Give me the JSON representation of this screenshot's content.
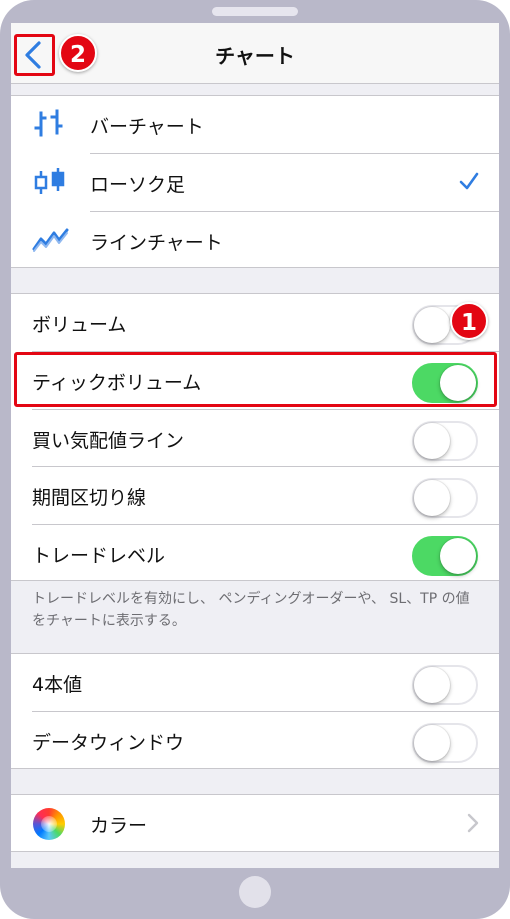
{
  "nav": {
    "title": "チャート",
    "back_badge": "2"
  },
  "chart_types": [
    {
      "label": "バーチャート",
      "icon": "bar-chart-icon",
      "checked": false
    },
    {
      "label": "ローソク足",
      "icon": "candlestick-icon",
      "checked": true
    },
    {
      "label": "ラインチャート",
      "icon": "line-chart-icon",
      "checked": false
    }
  ],
  "display_options": [
    {
      "label": "ボリューム",
      "on": false
    },
    {
      "label": "ティックボリューム",
      "on": true
    },
    {
      "label": "買い気配値ライン",
      "on": false
    },
    {
      "label": "期間区切り線",
      "on": false
    },
    {
      "label": "トレードレベル",
      "on": true
    }
  ],
  "toggle_badge": "1",
  "footnote": "トレードレベルを有効にし、 ペンディングオーダーや、 SL、TP の値をチャートに表示する。",
  "extra_options": [
    {
      "label": "4本値",
      "on": false
    },
    {
      "label": "データウィンドウ",
      "on": false
    }
  ],
  "color_row": {
    "label": "カラー",
    "icon": "color-wheel-icon"
  },
  "colors": {
    "accent": "#2f7de1",
    "toggle_on": "#4cd964",
    "annotation": "#e30613"
  }
}
